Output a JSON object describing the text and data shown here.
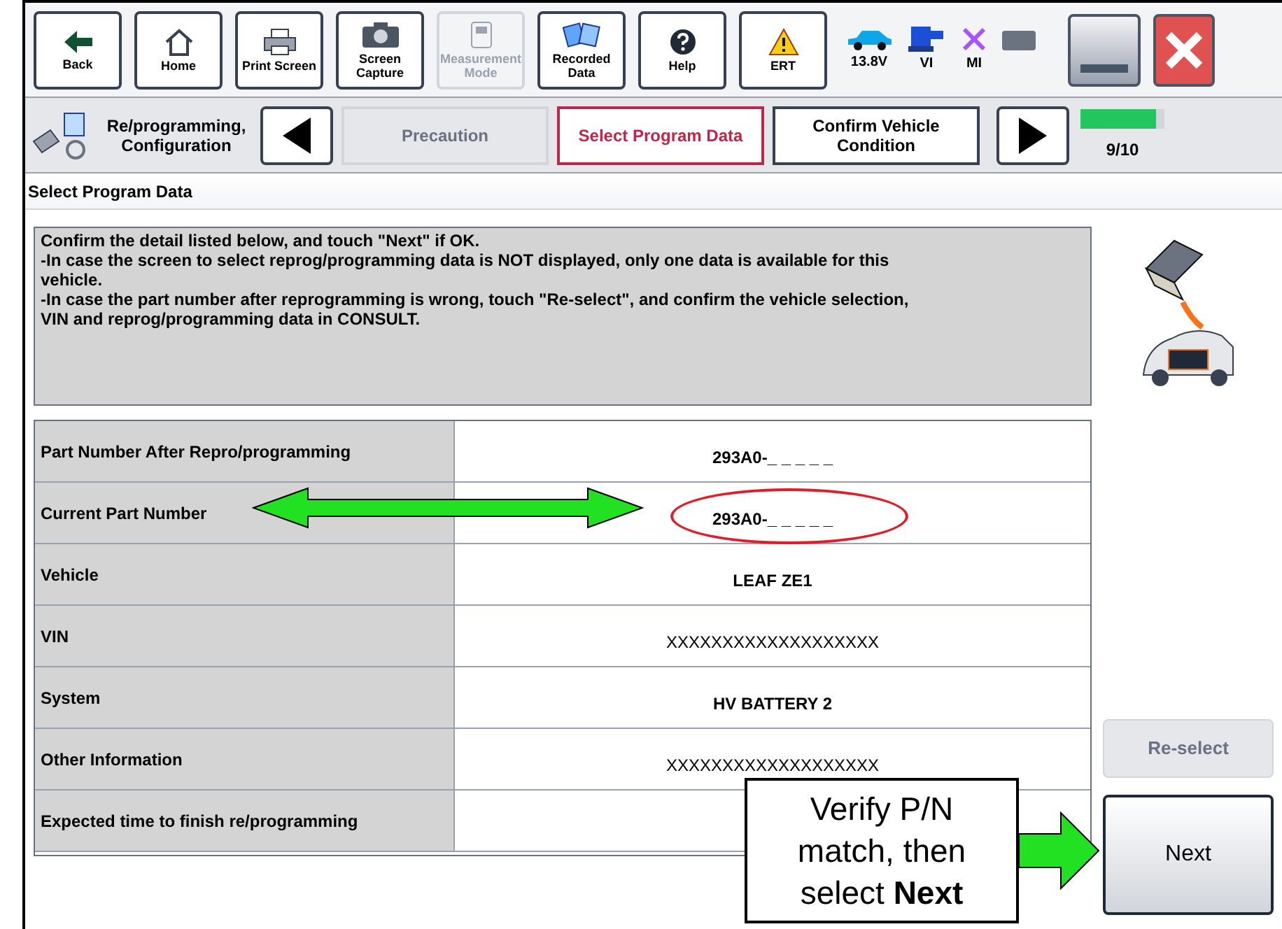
{
  "toolbar": [
    {
      "label": "Back",
      "disabled": false
    },
    {
      "label": "Home",
      "disabled": false
    },
    {
      "label": "Print Screen",
      "disabled": false
    },
    {
      "label": "Screen Capture",
      "disabled": false
    },
    {
      "label": "Measurement Mode",
      "disabled": true
    },
    {
      "label": "Recorded Data",
      "disabled": false
    },
    {
      "label": "Help",
      "disabled": false
    },
    {
      "label": "ERT",
      "disabled": false
    }
  ],
  "status": [
    {
      "label": "13.8V"
    },
    {
      "label": "VI"
    },
    {
      "label": "MI"
    }
  ],
  "steps_bar": {
    "section": "Re/programming, Configuration",
    "steps": [
      {
        "label": "Precaution",
        "selected": false,
        "disabled": true
      },
      {
        "label": "Select Program Data",
        "selected": true,
        "disabled": false
      },
      {
        "label": "Confirm Vehicle Condition",
        "selected": false,
        "disabled": false
      }
    ],
    "progress": {
      "level": 0.9,
      "text": "9/10"
    }
  },
  "page_title": "Select Program Data",
  "instructions": [
    "Confirm the detail listed below, and touch \"Next\" if OK.",
    "-In case the screen to select reprog/programming data is NOT displayed, only one data is available for this vehicle.",
    "-In case the part number after reprogramming is wrong, touch \"Re-select\", and confirm the vehicle selection, VIN and reprog/programming data in CONSULT."
  ],
  "table": [
    {
      "label": "Part Number After Repro/programming",
      "value": "293A0-_ _ _ _ _",
      "kind": "plain",
      "circled": false
    },
    {
      "label": "Current Part Number",
      "value": "293A0-_ _ _ _ _",
      "kind": "plain",
      "circled": true
    },
    {
      "label": "Vehicle",
      "value": "LEAF ZE1",
      "kind": "plain",
      "circled": false
    },
    {
      "label": "VIN",
      "value": "XXXXXXXXXXXXXXXXXXX",
      "kind": "masked",
      "circled": false
    },
    {
      "label": "System",
      "value": "HV BATTERY 2",
      "kind": "plain",
      "circled": false
    },
    {
      "label": "Other Information",
      "value": "XXXXXXXXXXXXXXXXXXX",
      "kind": "masked",
      "circled": false
    },
    {
      "label": "Expected time to finish re/programming",
      "circled": false
    }
  ],
  "buttons": [
    {
      "label": "Re-select",
      "disabled": true
    },
    {
      "label": "Next",
      "disabled": false
    }
  ],
  "callout": "Verify P/N match, then select **Next**"
}
